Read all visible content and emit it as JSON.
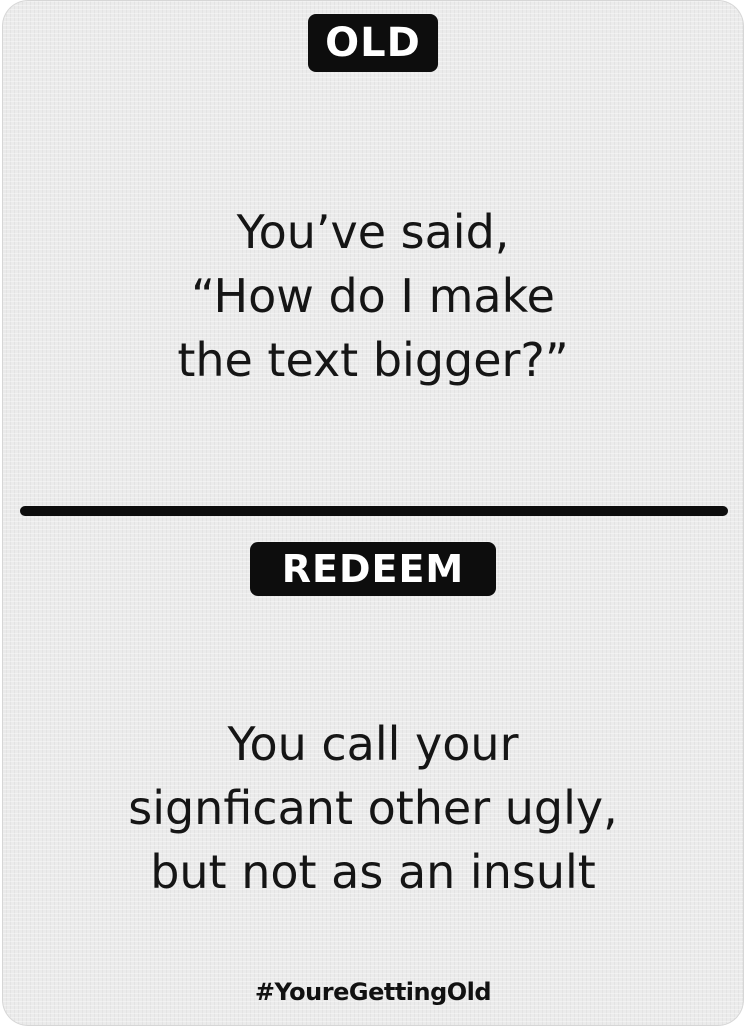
{
  "card": {
    "old_label": "OLD",
    "old_text": [
      "You’ve said,",
      "“How do I make",
      "the text bigger?”"
    ],
    "redeem_label": "REDEEM",
    "redeem_text": [
      "You call your",
      "signficant other ugly,",
      "but not as an insult"
    ],
    "hashtag": "#YoureGettingOld"
  },
  "colors": {
    "card_background": "#ebebeb",
    "ink": "#111111",
    "label_text": "#ffffff"
  }
}
